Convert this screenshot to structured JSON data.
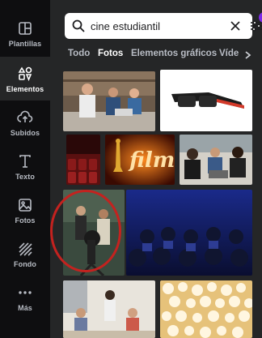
{
  "sidebar": {
    "items": [
      {
        "label": "Plantillas",
        "icon": "templates-icon"
      },
      {
        "label": "Elementos",
        "icon": "elements-icon"
      },
      {
        "label": "Subidos",
        "icon": "upload-cloud-icon"
      },
      {
        "label": "Texto",
        "icon": "text-icon"
      },
      {
        "label": "Fotos",
        "icon": "photos-icon"
      },
      {
        "label": "Fondo",
        "icon": "background-pattern-icon"
      },
      {
        "label": "Más",
        "icon": "more-dots-icon"
      }
    ],
    "active_index": 1
  },
  "search": {
    "value": "cine estudiantil",
    "filter_badge": "1"
  },
  "tabs": [
    "Todo",
    "Fotos",
    "Elementos gráficos",
    "Víde"
  ],
  "active_tab": 1,
  "photos": [
    {
      "subject": "students-with-laptop"
    },
    {
      "subject": "3d-glasses"
    },
    {
      "subject": "cinema-seats"
    },
    {
      "subject": "film-award-lettering",
      "text": "film"
    },
    {
      "subject": "students-around-laptop"
    },
    {
      "subject": "film-crew-camera-highlighted"
    },
    {
      "subject": "audience-in-cinema"
    },
    {
      "subject": "classroom-students"
    },
    {
      "subject": "popcorn"
    }
  ],
  "colors": {
    "accent": "#7d2ae8",
    "highlight_ring": "#c4221f",
    "sidebar_bg": "#0e0e10",
    "panel_bg": "#252627"
  }
}
